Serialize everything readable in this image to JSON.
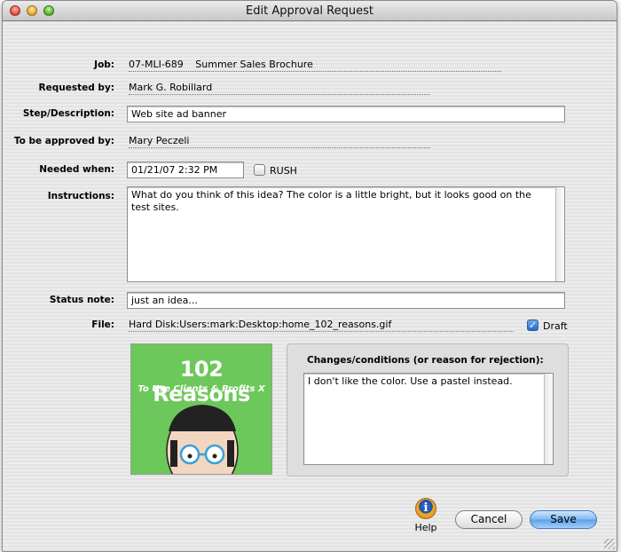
{
  "window": {
    "title": "Edit Approval Request"
  },
  "fields": {
    "job_label": "Job:",
    "job_number": "07-MLI-689",
    "job_name": "Summer Sales Brochure",
    "requested_by_label": "Requested by:",
    "requested_by": "Mark G. Robillard",
    "step_label": "Step/Description:",
    "step_value": "Web site ad banner",
    "approver_label": "To be approved by:",
    "approver": "Mary Peczeli",
    "needed_label": "Needed when:",
    "needed_value": "01/21/07 2:32 PM",
    "rush_label": "RUSH",
    "rush_checked": false,
    "instructions_label": "Instructions:",
    "instructions_value": "What do you think of this idea? The color is a little bright, but it looks good on the test sites.",
    "status_label": "Status note:",
    "status_value": "just an idea...",
    "file_label": "File:",
    "file_path": "Hard Disk:Users:mark:Desktop:home_102_reasons.gif",
    "draft_label": "Draft",
    "draft_checked": true
  },
  "preview": {
    "title": "102 Reasons",
    "subtitle": "To Use Clients & Profits X"
  },
  "changes": {
    "label": "Changes/conditions (or reason for rejection):",
    "value": "I don't like the color. Use a pastel instead."
  },
  "buttons": {
    "help": "Help",
    "cancel": "Cancel",
    "save": "Save"
  },
  "colors": {
    "preview_bg": "#6cc85a",
    "save_accent": "#5d9ee6"
  }
}
